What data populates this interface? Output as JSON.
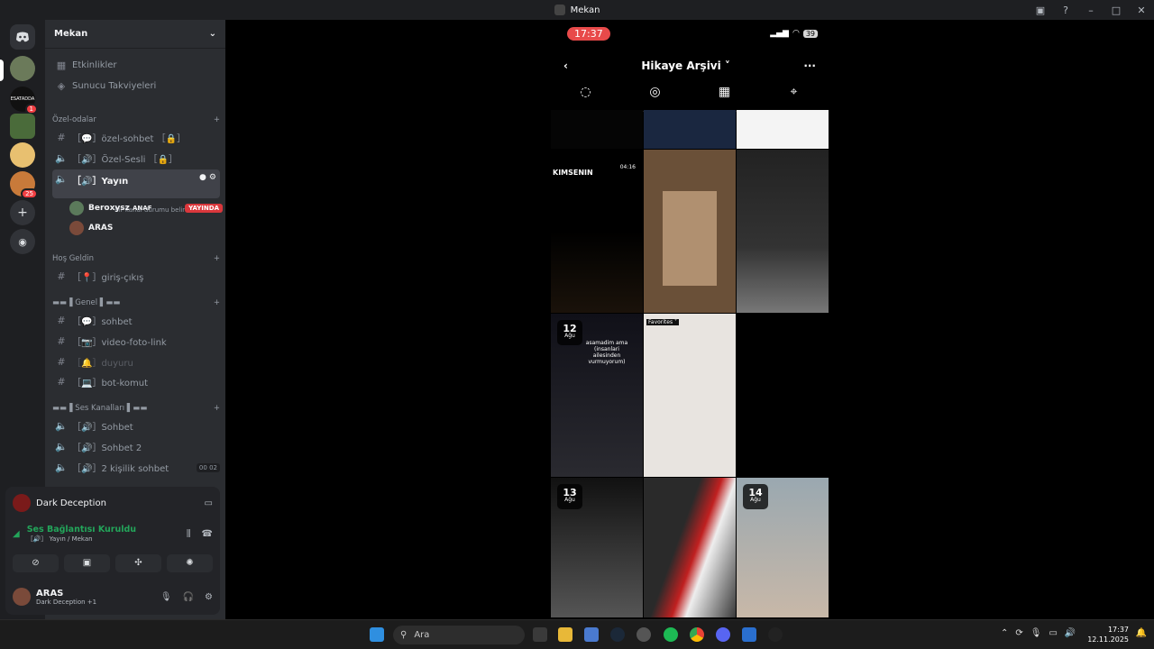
{
  "window": {
    "title": "Mekan"
  },
  "servers": {
    "badges": [
      "1",
      "25"
    ]
  },
  "sidebar": {
    "server_name": "Mekan",
    "top_items": [
      "Etkinlikler",
      "Sunucu Takviyeleri"
    ],
    "categories": {
      "ozel": "Özel-odalar",
      "hos": "Hoş Geldin",
      "genel": "▬▬▐ Genel ▌▬▬",
      "ses": "▬▬▐ Ses Kanalları ▌▬▬"
    },
    "channels": {
      "ozel_sohbet": "［💬］özel-sohbet ［🔒］",
      "ozel_sesli": "［🔊］Özel-Sesli ［🔒］",
      "yayin": "［🔊］Yayın",
      "yayin_status": "Bir kanal durumu belirle",
      "giris": "［📍］giriş-çıkış",
      "sohbet": "［💬］sohbet",
      "video": "［📷］video-foto-link",
      "duyuru": "［🔔］duyuru",
      "bot": "［💻］bot-komut",
      "ses1": "［🔊］Sohbet",
      "ses2": "［🔊］Sohbet 2",
      "ses3": "［🔊］2 kişilik sohbet",
      "ses3_count_a": "00",
      "ses3_count_b": "02"
    },
    "voice_users": [
      {
        "name": "Beroxysz",
        "tag": "ANAF",
        "live": "YAYINDA"
      },
      {
        "name": "ARAS"
      }
    ]
  },
  "panel": {
    "activity": "Dark Deception",
    "voice_status": "Ses Bağlantısı Kuruldu",
    "voice_channel": "［🔊］ Yayın / Mekan",
    "user_name": "ARAS",
    "user_status": "Dark Deception +1"
  },
  "phone": {
    "time": "17:37",
    "battery": "39",
    "title": "Hikaye Arşivi ˅",
    "grid_texts": {
      "kimsenin": "KIMSENIN",
      "time": "04:16",
      "caption": "asamadim ama (insanlari ailesinden vurmuyorum)",
      "favorites": "Favorites ˅"
    },
    "dates": [
      {
        "day": "12",
        "month": "Ağu"
      },
      {
        "day": "13",
        "month": "Ağu"
      },
      {
        "day": "14",
        "month": "Ağu"
      }
    ]
  },
  "taskbar": {
    "search_placeholder": "Ara",
    "time": "17:37",
    "date": "12.11.2025"
  },
  "colors": {
    "accent": "#5865f2",
    "green": "#23a55a",
    "live": "#da373c"
  }
}
